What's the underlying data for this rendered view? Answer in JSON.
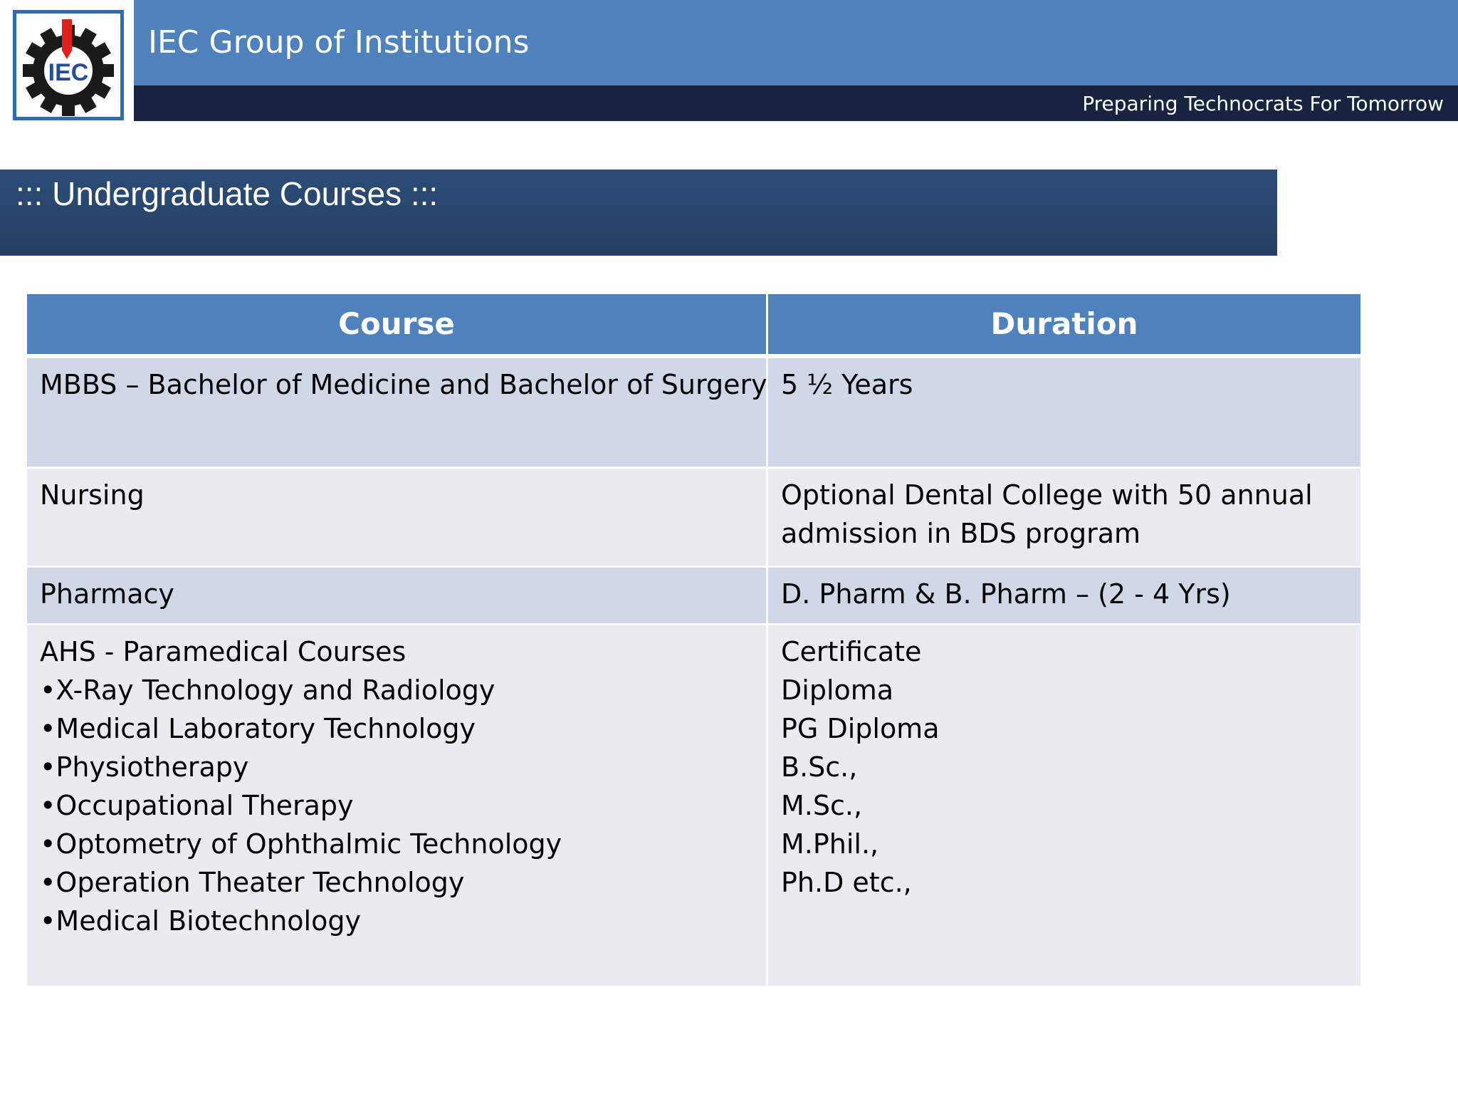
{
  "header": {
    "org_name": "IEC Group of Institutions",
    "tagline": "Preparing Technocrats For Tomorrow",
    "logo": {
      "text": "IEC",
      "icon": "gear-icon",
      "colors": {
        "border": "#2e6db3",
        "gear": "#1a1a1a",
        "accent": "#e02020",
        "text": "#1f4e9e"
      }
    }
  },
  "section": {
    "title": "::: Undergraduate Courses :::"
  },
  "table": {
    "headers": {
      "course": "Course",
      "duration": "Duration"
    },
    "rows": [
      {
        "course": [
          "MBBS – Bachelor of Medicine and Bachelor of Surgery"
        ],
        "duration": [
          "5 ½ Years"
        ]
      },
      {
        "course": [
          "Nursing"
        ],
        "duration": [
          "Optional Dental College with 50 annual",
          "admission in BDS program"
        ]
      },
      {
        "course": [
          "Pharmacy"
        ],
        "duration": [
          "D. Pharm & B. Pharm – (2 - 4 Yrs)"
        ]
      },
      {
        "course": [
          "AHS - Paramedical Courses",
          "•X-Ray Technology and Radiology",
          "•Medical Laboratory Technology",
          "•Physiotherapy",
          "•Occupational Therapy",
          "•Optometry of Ophthalmic Technology",
          "•Operation Theater Technology",
          "•Medical Biotechnology"
        ],
        "duration": [
          "Certificate",
          "Diploma",
          "PG Diploma",
          "B.Sc.,",
          "M.Sc.,",
          "M.Phil.,",
          "Ph.D etc.,"
        ]
      }
    ]
  },
  "colors": {
    "header_blue": "#4f81bd",
    "header_navy": "#17233f",
    "section_bar": "#2b4d78",
    "row_dark": "#d0d8e8",
    "row_light": "#e9ebf1"
  }
}
